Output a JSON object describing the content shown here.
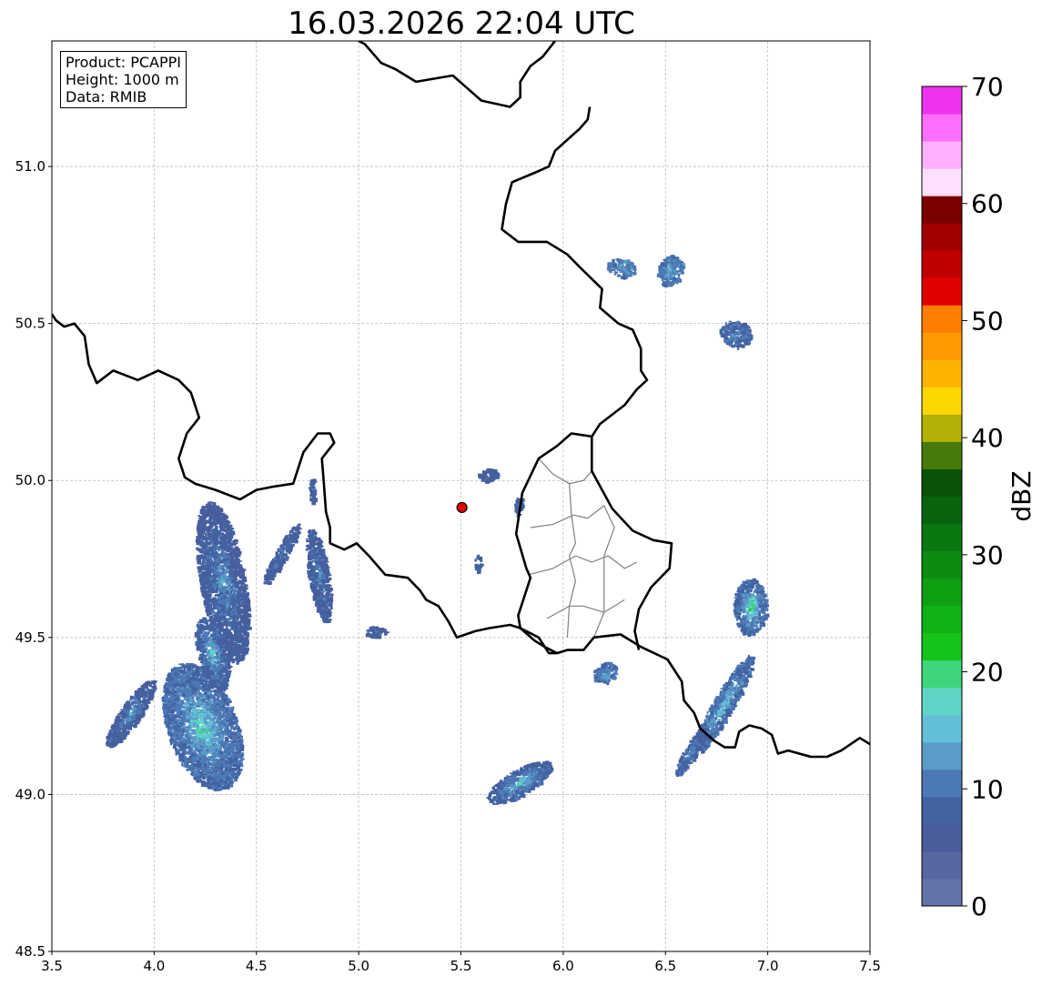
{
  "title": "16.03.2026 22:04 UTC",
  "info_box": [
    "Product: PCAPPI",
    "Height: 1000 m",
    "Data: RMIB"
  ],
  "map": {
    "lon_range": [
      3.5,
      7.5
    ],
    "lat_range": [
      48.5,
      51.4
    ],
    "x_ticks": [
      "3.5",
      "4.0",
      "4.5",
      "5.0",
      "5.5",
      "6.0",
      "6.5",
      "7.0",
      "7.5"
    ],
    "y_ticks": [
      "48.5",
      "49.0",
      "49.5",
      "50.0",
      "50.5",
      "51.0"
    ],
    "gridlines": true,
    "radar_site": {
      "lon": 5.505,
      "lat": 49.914,
      "color": "#e00000"
    }
  },
  "colorbar": {
    "label": "dBZ",
    "min": 0,
    "max": 70,
    "ticks": [
      "0",
      "10",
      "20",
      "30",
      "40",
      "50",
      "60",
      "70"
    ],
    "colors": [
      "#6574a8",
      "#5667a1",
      "#4a5c9c",
      "#4262a1",
      "#4c7ab6",
      "#5a9cc8",
      "#63bfd8",
      "#5fd6c5",
      "#3ed67a",
      "#15c41a",
      "#10b215",
      "#0f9f12",
      "#0d8b10",
      "#0a7710",
      "#07630d",
      "#0a5208",
      "#467a0a",
      "#b2b105",
      "#ffd700",
      "#ffb300",
      "#ff9a00",
      "#ff7d00",
      "#e10000",
      "#c00000",
      "#a00000",
      "#7a0000",
      "#ffe0ff",
      "#ffb0ff",
      "#ff6fff",
      "#ee33ee"
    ]
  },
  "echoes": [
    {
      "name": "west-cluster-main",
      "lon": 4.23,
      "lat": 49.22,
      "rx": 0.17,
      "ry": 0.21,
      "rot": -20,
      "dbz": 10,
      "core_dbz": 19
    },
    {
      "name": "west-band-north",
      "lon": 4.33,
      "lat": 49.68,
      "rx": 0.11,
      "ry": 0.26,
      "rot": -10,
      "dbz": 8,
      "core_dbz": 14
    },
    {
      "name": "west-band-mid",
      "lon": 4.28,
      "lat": 49.45,
      "rx": 0.07,
      "ry": 0.12,
      "rot": -15,
      "dbz": 9,
      "core_dbz": 18
    },
    {
      "name": "west-strip",
      "lon": 3.88,
      "lat": 49.26,
      "rx": 0.05,
      "ry": 0.13,
      "rot": 35,
      "dbz": 8,
      "core_dbz": 14
    },
    {
      "name": "strip-4-8",
      "lon": 4.8,
      "lat": 49.7,
      "rx": 0.05,
      "ry": 0.15,
      "rot": -10,
      "dbz": 8,
      "core_dbz": 13
    },
    {
      "name": "strip-4-6",
      "lon": 4.62,
      "lat": 49.77,
      "rx": 0.03,
      "ry": 0.11,
      "rot": 30,
      "dbz": 8,
      "core_dbz": 11
    },
    {
      "name": "small-5-1",
      "lon": 5.08,
      "lat": 49.52,
      "rx": 0.05,
      "ry": 0.018,
      "rot": 0,
      "dbz": 8,
      "core_dbz": 10
    },
    {
      "name": "south-5-8",
      "lon": 5.78,
      "lat": 49.04,
      "rx": 0.18,
      "ry": 0.04,
      "rot": -30,
      "dbz": 9,
      "core_dbz": 18
    },
    {
      "name": "small-6-2",
      "lon": 6.2,
      "lat": 49.39,
      "rx": 0.06,
      "ry": 0.03,
      "rot": -30,
      "dbz": 10,
      "core_dbz": 16
    },
    {
      "name": "east-band-1",
      "lon": 6.78,
      "lat": 49.29,
      "rx": 0.05,
      "ry": 0.18,
      "rot": 30,
      "dbz": 10,
      "core_dbz": 17
    },
    {
      "name": "east-band-2",
      "lon": 6.62,
      "lat": 49.14,
      "rx": 0.03,
      "ry": 0.09,
      "rot": 30,
      "dbz": 9,
      "core_dbz": 14
    },
    {
      "name": "east-cell",
      "lon": 6.91,
      "lat": 49.6,
      "rx": 0.08,
      "ry": 0.09,
      "rot": 0,
      "dbz": 10,
      "core_dbz": 21
    },
    {
      "name": "ne-cell-1",
      "lon": 6.28,
      "lat": 50.68,
      "rx": 0.07,
      "ry": 0.028,
      "rot": 10,
      "dbz": 11,
      "core_dbz": 14
    },
    {
      "name": "ne-cell-2",
      "lon": 6.52,
      "lat": 50.67,
      "rx": 0.06,
      "ry": 0.05,
      "rot": 20,
      "dbz": 11,
      "core_dbz": 15
    },
    {
      "name": "ne-cell-3",
      "lon": 6.84,
      "lat": 50.47,
      "rx": 0.08,
      "ry": 0.04,
      "rot": 20,
      "dbz": 9,
      "core_dbz": 12
    },
    {
      "name": "near-radar-1",
      "lon": 5.63,
      "lat": 50.02,
      "rx": 0.05,
      "ry": 0.02,
      "rot": 0,
      "dbz": 8,
      "core_dbz": 10
    },
    {
      "name": "near-radar-2",
      "lon": 5.58,
      "lat": 49.74,
      "rx": 0.015,
      "ry": 0.03,
      "rot": 0,
      "dbz": 8,
      "core_dbz": 10
    },
    {
      "name": "near-radar-3",
      "lon": 5.78,
      "lat": 49.92,
      "rx": 0.02,
      "ry": 0.03,
      "rot": 0,
      "dbz": 8,
      "core_dbz": 10
    },
    {
      "name": "near-radar-4",
      "lon": 4.77,
      "lat": 49.97,
      "rx": 0.015,
      "ry": 0.04,
      "rot": 0,
      "dbz": 8,
      "core_dbz": 9
    }
  ],
  "borders": [
    {
      "name": "border-be-nl",
      "points": [
        [
          3.5,
          50.53
        ],
        [
          3.52,
          50.51
        ],
        [
          3.56,
          50.49
        ],
        [
          3.61,
          50.5
        ],
        [
          3.66,
          50.46
        ],
        [
          3.68,
          50.37
        ],
        [
          3.72,
          50.31
        ],
        [
          3.8,
          50.35
        ],
        [
          3.92,
          50.32
        ],
        [
          4.02,
          50.35
        ],
        [
          4.12,
          50.32
        ],
        [
          4.18,
          50.28
        ],
        [
          4.2,
          50.24
        ],
        [
          4.22,
          50.2
        ],
        [
          4.16,
          50.15
        ],
        [
          4.12,
          50.07
        ],
        [
          4.15,
          50.01
        ],
        [
          4.2,
          49.99
        ],
        [
          4.3,
          49.97
        ],
        [
          4.42,
          49.94
        ],
        [
          4.5,
          49.97
        ],
        [
          4.58,
          49.98
        ],
        [
          4.68,
          49.99
        ],
        [
          4.73,
          50.09
        ],
        [
          4.8,
          50.15
        ],
        [
          4.86,
          50.15
        ],
        [
          4.88,
          50.12
        ],
        [
          4.82,
          50.07
        ],
        [
          4.83,
          49.99
        ],
        [
          4.84,
          49.9
        ],
        [
          4.86,
          49.85
        ],
        [
          4.86,
          49.8
        ],
        [
          4.93,
          49.78
        ],
        [
          4.99,
          49.8
        ],
        [
          5.05,
          49.76
        ],
        [
          5.13,
          49.7
        ],
        [
          5.24,
          49.69
        ],
        [
          5.3,
          49.65
        ],
        [
          5.33,
          49.62
        ],
        [
          5.39,
          49.6
        ],
        [
          5.44,
          49.55
        ],
        [
          5.48,
          49.5
        ],
        [
          5.57,
          49.52
        ],
        [
          5.64,
          49.53
        ],
        [
          5.74,
          49.54
        ],
        [
          5.79,
          49.53
        ],
        [
          5.86,
          49.49
        ],
        [
          5.91,
          49.47
        ],
        [
          5.97,
          49.45
        ],
        [
          6.02,
          49.46
        ],
        [
          6.1,
          49.46
        ],
        [
          6.15,
          49.5
        ],
        [
          6.28,
          49.51
        ],
        [
          6.38,
          49.47
        ],
        [
          6.51,
          49.43
        ],
        [
          6.58,
          49.36
        ],
        [
          6.59,
          49.3
        ],
        [
          6.64,
          49.26
        ],
        [
          6.67,
          49.21
        ],
        [
          6.74,
          49.17
        ],
        [
          6.79,
          49.15
        ],
        [
          6.84,
          49.15
        ],
        [
          6.86,
          49.2
        ],
        [
          6.91,
          49.22
        ],
        [
          6.97,
          49.21
        ],
        [
          7.02,
          49.19
        ],
        [
          7.05,
          49.13
        ],
        [
          7.1,
          49.14
        ],
        [
          7.21,
          49.12
        ],
        [
          7.29,
          49.12
        ],
        [
          7.36,
          49.14
        ],
        [
          7.45,
          49.18
        ],
        [
          7.5,
          49.16
        ]
      ]
    },
    {
      "name": "border-de-be",
      "points": [
        [
          5.96,
          51.4
        ],
        [
          5.9,
          51.35
        ],
        [
          5.84,
          51.32
        ],
        [
          5.79,
          51.27
        ],
        [
          5.79,
          51.22
        ],
        [
          5.74,
          51.19
        ],
        [
          5.6,
          51.21
        ],
        [
          5.46,
          51.29
        ],
        [
          5.28,
          51.27
        ],
        [
          5.18,
          51.31
        ],
        [
          5.11,
          51.33
        ],
        [
          5.03,
          51.39
        ],
        [
          5.0,
          51.4
        ]
      ]
    },
    {
      "name": "border-de-lux-fr",
      "points": [
        [
          6.13,
          51.19
        ],
        [
          6.12,
          51.15
        ],
        [
          6.08,
          51.12
        ],
        [
          5.96,
          51.05
        ],
        [
          5.93,
          51.0
        ],
        [
          5.86,
          50.98
        ],
        [
          5.75,
          50.95
        ],
        [
          5.72,
          50.88
        ],
        [
          5.7,
          50.8
        ],
        [
          5.78,
          50.76
        ],
        [
          5.92,
          50.76
        ],
        [
          6.02,
          50.72
        ],
        [
          6.08,
          50.68
        ],
        [
          6.19,
          50.61
        ],
        [
          6.18,
          50.55
        ],
        [
          6.27,
          50.5
        ],
        [
          6.34,
          50.48
        ],
        [
          6.38,
          50.42
        ],
        [
          6.38,
          50.35
        ],
        [
          6.41,
          50.32
        ],
        [
          6.36,
          50.29
        ],
        [
          6.3,
          50.24
        ],
        [
          6.18,
          50.18
        ],
        [
          6.14,
          50.14
        ],
        [
          6.04,
          50.15
        ],
        [
          5.97,
          50.11
        ],
        [
          5.88,
          50.07
        ],
        [
          5.8,
          49.96
        ],
        [
          5.77,
          49.83
        ],
        [
          5.82,
          49.72
        ],
        [
          5.84,
          49.69
        ],
        [
          5.78,
          49.57
        ],
        [
          5.79,
          49.53
        ],
        [
          5.88,
          49.5
        ],
        [
          5.93,
          49.45
        ],
        [
          5.97,
          49.45
        ]
      ]
    },
    {
      "name": "border-lux-de",
      "points": [
        [
          6.14,
          50.14
        ],
        [
          6.14,
          50.03
        ],
        [
          6.24,
          49.91
        ],
        [
          6.34,
          49.84
        ],
        [
          6.44,
          49.81
        ],
        [
          6.53,
          49.8
        ],
        [
          6.52,
          49.72
        ],
        [
          6.43,
          49.66
        ],
        [
          6.37,
          49.59
        ],
        [
          6.35,
          49.52
        ],
        [
          6.37,
          49.46
        ]
      ]
    }
  ],
  "districts": [
    {
      "name": "district-north",
      "points": [
        [
          5.88,
          50.07
        ],
        [
          5.95,
          50.02
        ],
        [
          6.03,
          49.99
        ],
        [
          6.1,
          50.0
        ],
        [
          6.14,
          50.03
        ]
      ]
    },
    {
      "name": "district-center",
      "points": [
        [
          5.84,
          49.85
        ],
        [
          5.95,
          49.86
        ],
        [
          6.05,
          49.89
        ],
        [
          6.12,
          49.88
        ],
        [
          6.2,
          49.92
        ]
      ]
    },
    {
      "name": "district-south-1",
      "points": [
        [
          5.83,
          49.7
        ],
        [
          5.95,
          49.72
        ],
        [
          6.06,
          49.76
        ],
        [
          6.14,
          49.74
        ],
        [
          6.22,
          49.76
        ],
        [
          6.3,
          49.72
        ],
        [
          6.36,
          49.74
        ]
      ]
    },
    {
      "name": "district-south-2",
      "points": [
        [
          5.92,
          49.56
        ],
        [
          6.03,
          49.6
        ],
        [
          6.1,
          49.6
        ],
        [
          6.2,
          49.58
        ],
        [
          6.3,
          49.62
        ]
      ]
    },
    {
      "name": "district-vert-1",
      "points": [
        [
          6.03,
          49.99
        ],
        [
          6.04,
          49.89
        ],
        [
          6.06,
          49.8
        ],
        [
          6.03,
          49.76
        ],
        [
          6.06,
          49.68
        ],
        [
          6.03,
          49.6
        ],
        [
          6.02,
          49.5
        ]
      ]
    },
    {
      "name": "district-vert-2",
      "points": [
        [
          6.2,
          49.92
        ],
        [
          6.25,
          49.85
        ],
        [
          6.2,
          49.76
        ],
        [
          6.2,
          49.67
        ],
        [
          6.2,
          49.58
        ],
        [
          6.15,
          49.5
        ]
      ]
    }
  ]
}
